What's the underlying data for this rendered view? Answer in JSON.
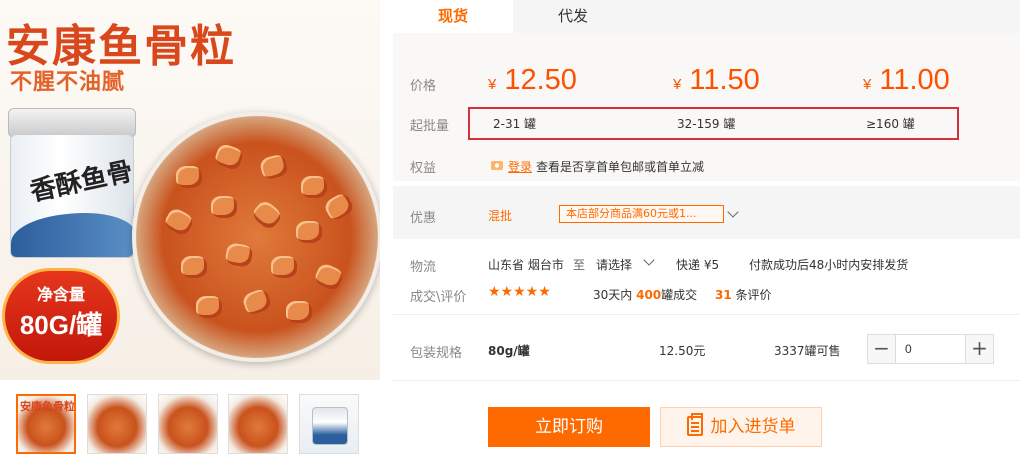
{
  "hero": {
    "title": "安康鱼骨粒",
    "subtitle": "不腥不油腻",
    "jar_text": "香酥鱼骨",
    "badge_label": "净含量",
    "badge_value": "80G/罐"
  },
  "thumbnails": {
    "first_title": "安康鱼骨粒",
    "count": 5
  },
  "tabs": [
    {
      "label": "现货"
    },
    {
      "label": "代发"
    }
  ],
  "pricing": {
    "price_label": "价格",
    "currency": "¥",
    "tiers": [
      {
        "price": "12.50",
        "range": "2-31 罐"
      },
      {
        "price": "11.50",
        "range": "32-159 罐"
      },
      {
        "price": "11.00",
        "range": "≥160 罐"
      }
    ],
    "moq_label": "起批量"
  },
  "benefits": {
    "label": "权益",
    "login_text": "登录",
    "desc": "查看是否享首单包邮或首单立减"
  },
  "promo": {
    "label": "优惠",
    "type": "混批",
    "tag_text": "本店部分商品满60元或1..."
  },
  "logistics": {
    "label": "物流",
    "origin": "山东省 烟台市",
    "to": "至",
    "select": "请选择",
    "express": "快递 ¥5",
    "dispatch": "付款成功后48小时内安排发货"
  },
  "reviews": {
    "label": "成交\\评价",
    "stars": "★★★★★",
    "period": "30天内",
    "sold_count": "400",
    "sold_suffix": "罐成交",
    "review_count": "31",
    "review_suffix": "条评价"
  },
  "spec": {
    "label": "包装规格",
    "name": "80g/罐",
    "price": "12.50元",
    "stock": "3337罐可售",
    "quantity": "0",
    "minus": "−",
    "plus": "+"
  },
  "actions": {
    "buy": "立即订购",
    "cart": "加入进货单"
  },
  "colors": {
    "accent": "#ff6a00",
    "price": "#ff5000",
    "highlight_box": "#d3323c"
  }
}
